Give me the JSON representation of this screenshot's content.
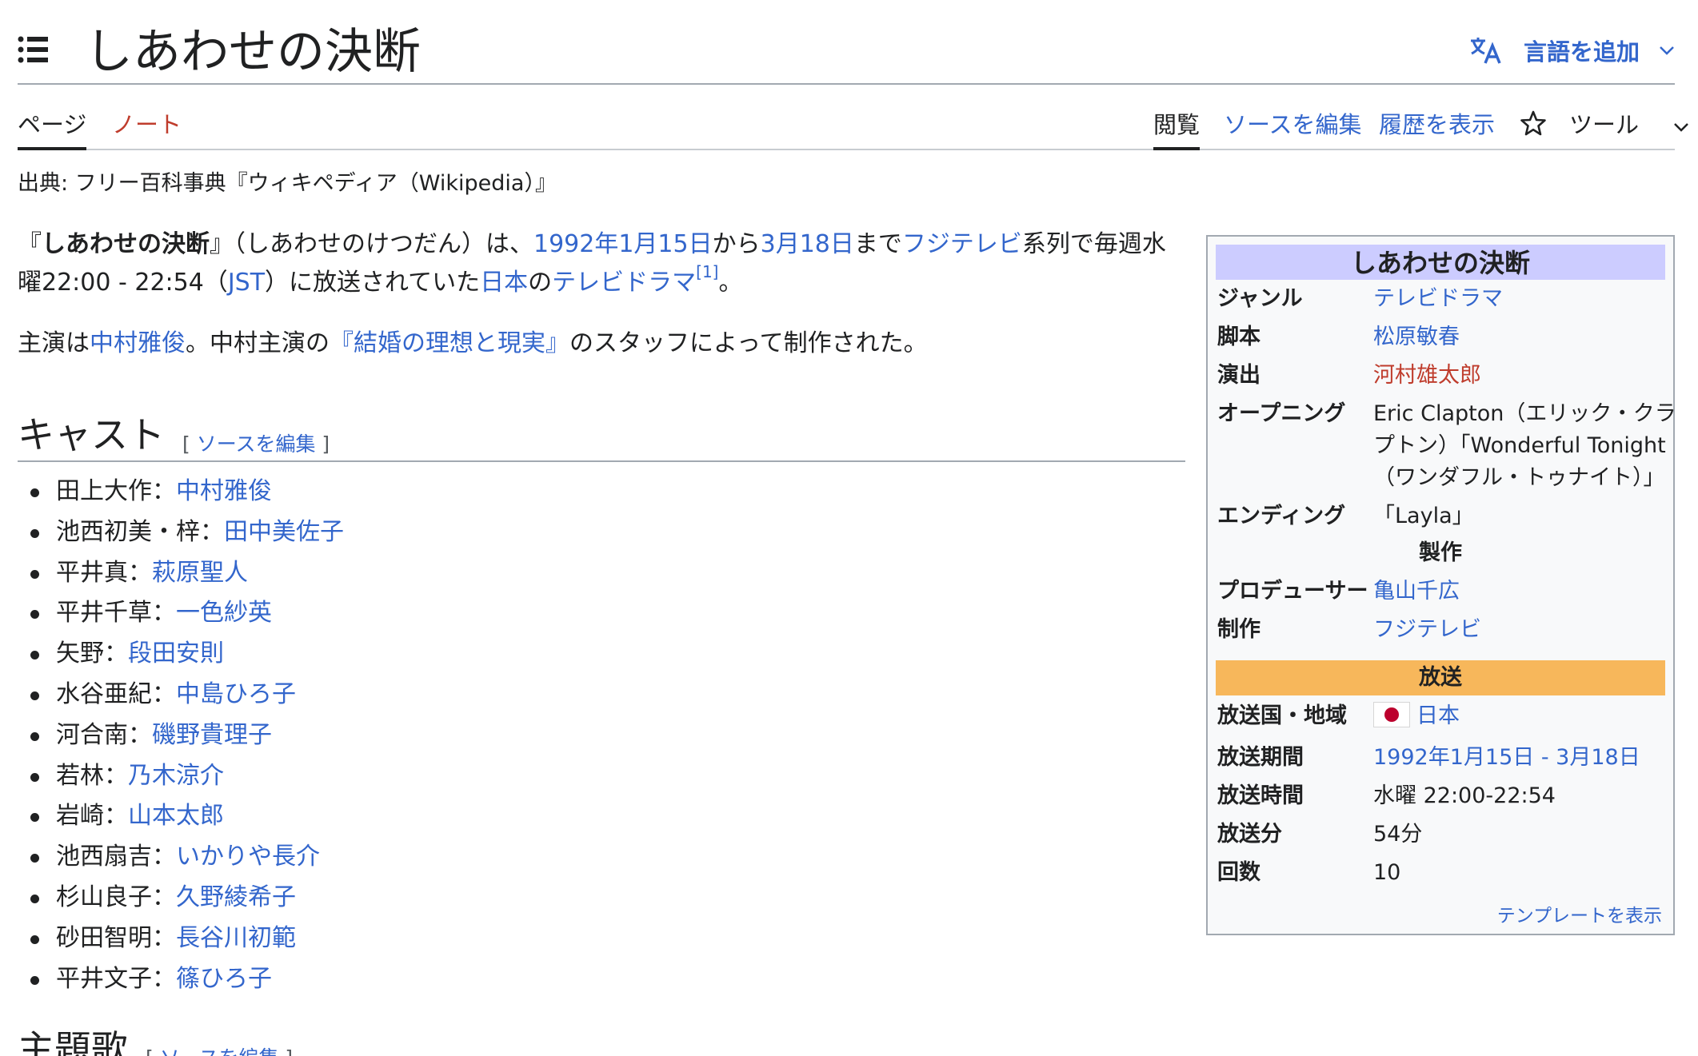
{
  "header": {
    "title": "しあわせの決断",
    "language_button": "言語を追加",
    "icons": {
      "toc": "list-icon",
      "language": "translate-icon",
      "chevron": "chevron-down-icon"
    }
  },
  "tabs": {
    "page": "ページ",
    "talk": "ノート",
    "read": "閲覧",
    "edit_source": "ソースを編集",
    "history": "履歴を表示",
    "tools": "ツール",
    "icons": {
      "watch": "star-icon",
      "chevron": "chevron-down-icon"
    }
  },
  "subtitle": "出典: フリー百科事典『ウィキペディア（Wikipedia）』",
  "intro": {
    "q_open": "『",
    "title_bold": "しあわせの決断",
    "t1": "』（しあわせのけつだん）は、",
    "l_start_date": "1992年1月15日",
    "t2": "から",
    "l_end_date": "3月18日",
    "t3": "まで",
    "l_fujitv": "フジテレビ",
    "t4": "系列で毎週水曜22:00 - 22:54（",
    "l_jst": "JST",
    "t5": "）に放送されていた",
    "l_japan": "日本",
    "t6": "の",
    "l_tvdrama": "テレビドラマ",
    "ref": "[1]",
    "t7": "。"
  },
  "lead2": {
    "t1": "主演は",
    "l_star": "中村雅俊",
    "t2": "。中村主演の",
    "l_show": "『結婚の理想と現実』",
    "t3": "のスタッフによって制作された。"
  },
  "cast_section": {
    "heading": "キャスト",
    "edit_open": "[ ",
    "edit_label": "ソースを編集",
    "edit_close": " ]",
    "items": [
      {
        "role": "田上大作：",
        "actor": "中村雅俊"
      },
      {
        "role": "池西初美・梓：",
        "actor": "田中美佐子"
      },
      {
        "role": "平井真：",
        "actor": "萩原聖人"
      },
      {
        "role": "平井千草：",
        "actor": "一色紗英"
      },
      {
        "role": "矢野：",
        "actor": "段田安則"
      },
      {
        "role": "水谷亜紀：",
        "actor": "中島ひろ子"
      },
      {
        "role": "河合南：",
        "actor": "磯野貴理子"
      },
      {
        "role": "若林：",
        "actor": "乃木涼介"
      },
      {
        "role": "岩崎：",
        "actor": "山本太郎"
      },
      {
        "role": "池西扇吉：",
        "actor": "いかりや長介"
      },
      {
        "role": "杉山良子：",
        "actor": "久野綾希子"
      },
      {
        "role": "砂田智明：",
        "actor": "長谷川初範"
      },
      {
        "role": "平井文子：",
        "actor": "篠ひろ子"
      }
    ]
  },
  "theme_section": {
    "heading": "主題歌",
    "edit_open": "[ ",
    "edit_label": "ソースを編集",
    "edit_close": " ]"
  },
  "infobox": {
    "title": "しあわせの決断",
    "genre_label": "ジャンル",
    "genre": "テレビドラマ",
    "script_label": "脚本",
    "script": "松原敏春",
    "director_label": "演出",
    "director": "河村雄太郎",
    "opening_label": "オープニング",
    "opening_line1": "Eric Clapton（エリック・クラ",
    "opening_line2": "プトン）「Wonderful Tonight",
    "opening_line3": "（ワンダフル・トゥナイト）」",
    "ending_label": "エンディング",
    "ending": "「Layla」",
    "production_head": "製作",
    "producer_label": "プロデューサー",
    "producer": "亀山千広",
    "produced_label": "制作",
    "produced": "フジテレビ",
    "broadcast_head": "放送",
    "country_label": "放送国・地域",
    "country": "日本",
    "period_label": "放送期間",
    "period": "1992年1月15日 - 3月18日",
    "time_label": "放送時間",
    "time": "水曜 22:00-22:54",
    "duration_label": "放送分",
    "duration": "54分",
    "episodes_label": "回数",
    "episodes": "10",
    "template_link": "テンプレートを表示",
    "flag_icon": "japan-flag-icon"
  },
  "colors": {
    "link": "#3366cc",
    "redlink": "#bf3c2c",
    "infobox_title_bg": "#ccccff",
    "broadcast_head_bg": "#f7b75b"
  }
}
